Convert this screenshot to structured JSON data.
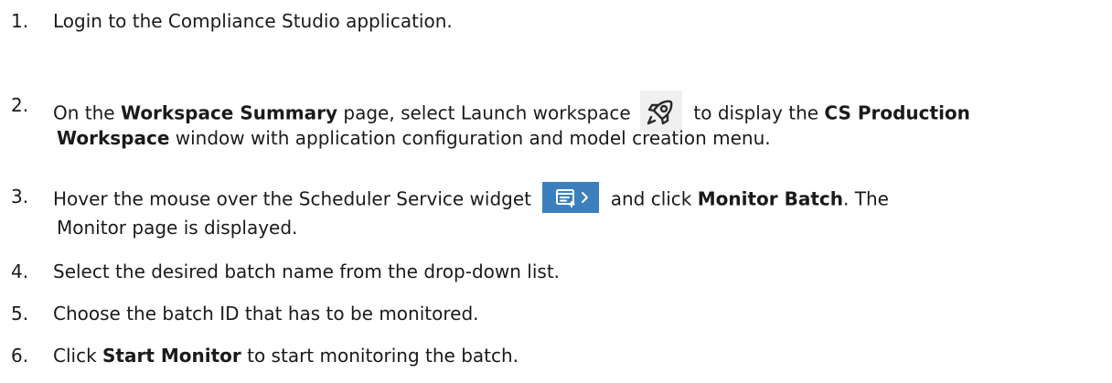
{
  "steps": [
    {
      "number": "1.",
      "text": "Login to the Compliance Studio application."
    },
    {
      "number": "2.",
      "part1": "On the ",
      "bold1": "Workspace Summary",
      "part2": " page, select Launch workspace ",
      "part3": " to display the ",
      "bold2": "CS Production",
      "bold3": "Workspace",
      "part4": " window with application configuration and model creation menu."
    },
    {
      "number": "3.",
      "part1": "Hover the mouse over the Scheduler Service widget ",
      "part2": " and click ",
      "bold1": "Monitor Batch",
      "part3": ". The",
      "part4": "Monitor page is displayed."
    },
    {
      "number": "4.",
      "text": "Select the desired batch name from the drop-down list."
    },
    {
      "number": "5.",
      "text": "Choose the batch ID that has to be monitored."
    },
    {
      "number": "6.",
      "part1": "Click ",
      "bold1": "Start Monitor",
      "part2": " to start monitoring the batch."
    }
  ],
  "icons": {
    "launch": "rocket-icon",
    "scheduler": "scheduler-widget-icon"
  },
  "colors": {
    "scheduler_bg": "#3b80bc",
    "rocket_bg": "#f0f0f0"
  }
}
